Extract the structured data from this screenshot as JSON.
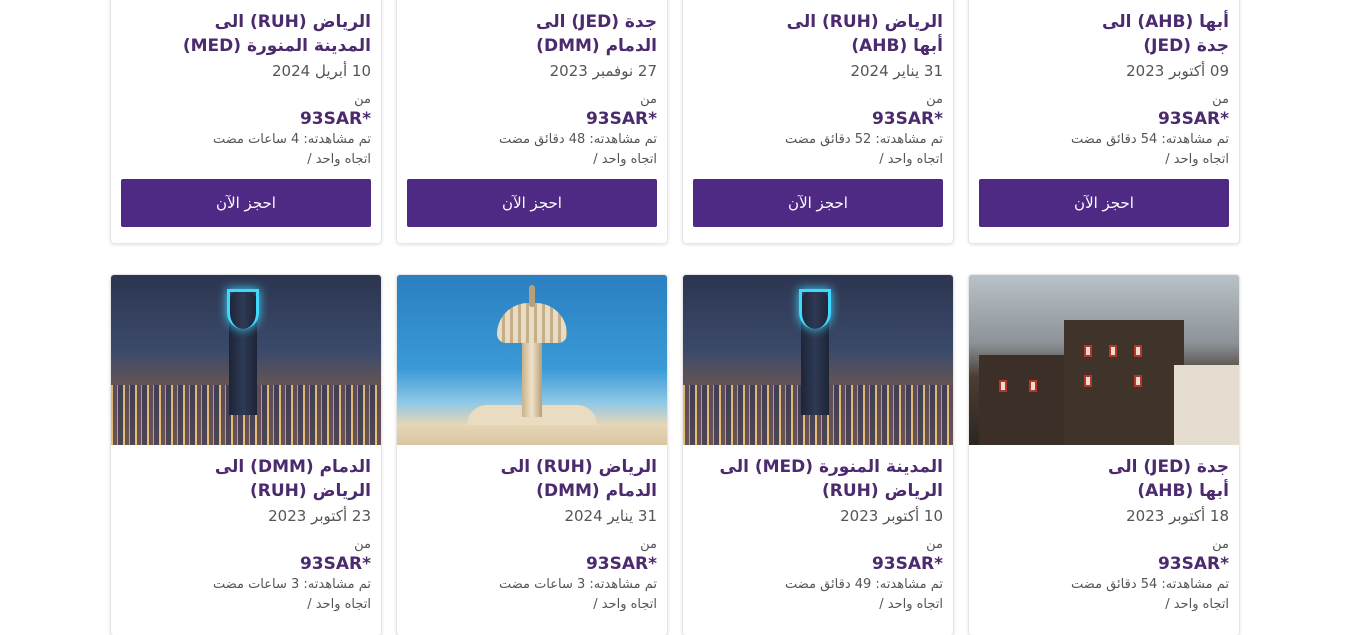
{
  "currency_note": "*",
  "labels": {
    "from": "من",
    "book_now": "احجز الآن",
    "one_way": "اتجاه واحد",
    "slash": "/"
  },
  "row1": [
    {
      "title_line1": "أبها (AHB) الى",
      "title_line2": "جدة (JED)",
      "date": "09 أكتوبر 2023",
      "price": "93SAR*",
      "seen": "تم مشاهدته: 54 دقائق مضت"
    },
    {
      "title_line1": "الرياض (RUH) الى",
      "title_line2": "أبها (AHB)",
      "date": "31 يناير 2024",
      "price": "93SAR*",
      "seen": "تم مشاهدته: 52 دقائق مضت"
    },
    {
      "title_line1": "جدة (JED) الى",
      "title_line2": "الدمام (DMM)",
      "date": "27 نوفمبر 2023",
      "price": "93SAR*",
      "seen": "تم مشاهدته: 48 دقائق مضت"
    },
    {
      "title_line1": "الرياض (RUH) الى",
      "title_line2": "المدينة المنورة (MED)",
      "date": "10 أبريل 2024",
      "price": "93SAR*",
      "seen": "تم مشاهدته: 4 ساعات مضت"
    }
  ],
  "row2": [
    {
      "image": "stone-houses",
      "title_line1": "جدة (JED) الى",
      "title_line2": "أبها (AHB)",
      "date": "18 أكتوبر 2023",
      "price": "93SAR*",
      "seen": "تم مشاهدته: 54 دقائق مضت"
    },
    {
      "image": "riyadh-night",
      "title_line1": "المدينة المنورة (MED) الى",
      "title_line2": "الرياض (RUH)",
      "date": "10 أكتوبر 2023",
      "price": "93SAR*",
      "seen": "تم مشاهدته: 49 دقائق مضت"
    },
    {
      "image": "water-tower",
      "title_line1": "الرياض (RUH) الى",
      "title_line2": "الدمام (DMM)",
      "date": "31 يناير 2024",
      "price": "93SAR*",
      "seen": "تم مشاهدته: 3 ساعات مضت"
    },
    {
      "image": "riyadh-night",
      "title_line1": "الدمام (DMM) الى",
      "title_line2": "الرياض (RUH)",
      "date": "23 أكتوبر 2023",
      "price": "93SAR*",
      "seen": "تم مشاهدته: 3 ساعات مضت"
    }
  ],
  "colors": {
    "accent": "#4e2a84",
    "title": "#4b2a6e"
  }
}
